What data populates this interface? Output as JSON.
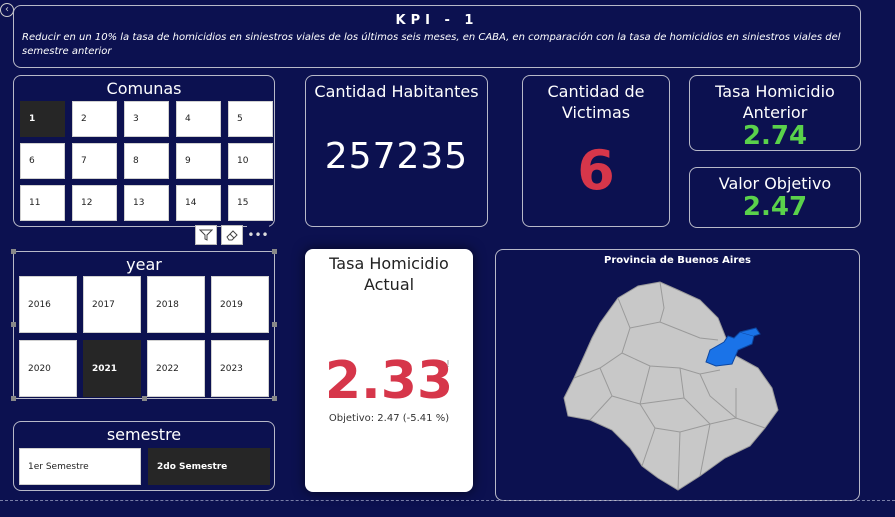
{
  "header": {
    "title": "KPI - 1",
    "description": "Reducir en un 10% la tasa de homicidios en siniestros viales de los últimos seis meses, en CABA, en comparación con la tasa de homicidios en siniestros viales del semestre anterior"
  },
  "comunas": {
    "title": "Comunas",
    "items": [
      "1",
      "2",
      "3",
      "4",
      "5",
      "6",
      "7",
      "8",
      "9",
      "10",
      "11",
      "12",
      "13",
      "14",
      "15"
    ],
    "selected": "1"
  },
  "year": {
    "title": "year",
    "items": [
      "2016",
      "2017",
      "2018",
      "2019",
      "2020",
      "2021",
      "2022",
      "2023"
    ],
    "selected": "2021"
  },
  "semestre": {
    "title": "semestre",
    "items": [
      "1er Semestre",
      "2do Semestre"
    ],
    "selected": "2do Semestre"
  },
  "habitantes": {
    "title": "Cantidad Habitantes",
    "value": "257235"
  },
  "victimas": {
    "title": "Cantidad de Victimas",
    "value": "6"
  },
  "tasa_anterior": {
    "title": "Tasa Homicidio Anterior",
    "value": "2.74"
  },
  "valor_objetivo": {
    "title": "Valor Objetivo",
    "value": "2.47"
  },
  "tasa_actual": {
    "title": "Tasa Homicidio Actual",
    "value": "2.33",
    "indicator": "!",
    "goal_text": "Objetivo: 2.47 (-5.41 %)"
  },
  "map": {
    "title": "Provincia de Buenos Aires"
  },
  "colors": {
    "background": "#0c1150",
    "red": "#d6364a",
    "green": "#5ad24b",
    "map_highlight": "#1a73e8",
    "map_fill": "#c8c8c8"
  },
  "icons": [
    "filter-icon",
    "eraser-icon",
    "more-options-icon",
    "back-arrow-icon"
  ]
}
